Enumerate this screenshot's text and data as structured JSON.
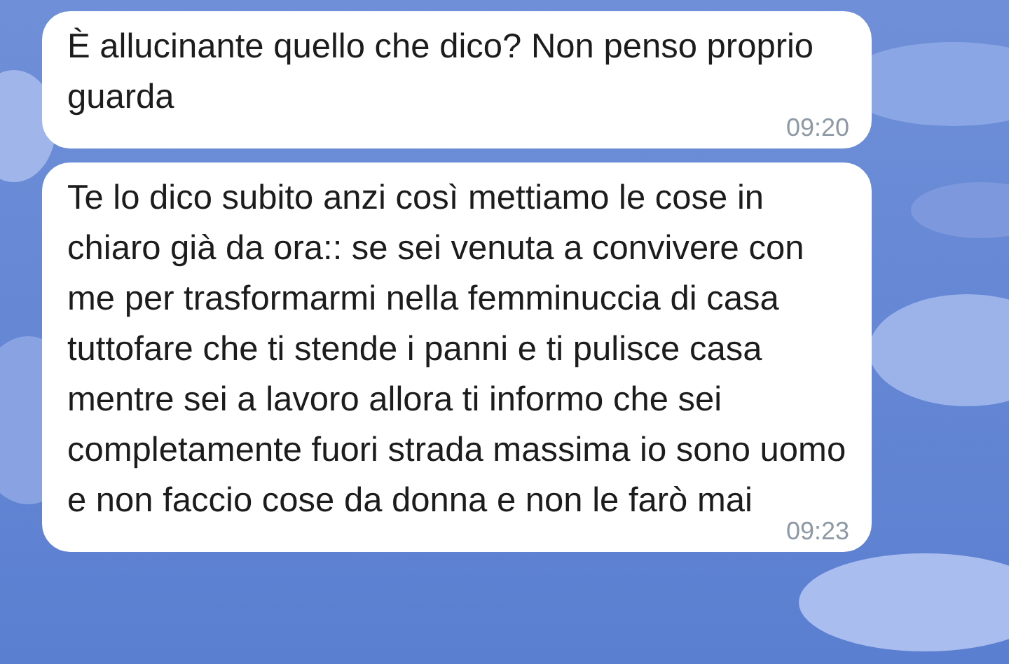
{
  "messages": [
    {
      "text": "È allucinante quello che dico? Non penso proprio guarda",
      "time": "09:20"
    },
    {
      "text": "Te lo dico subito anzi così mettiamo le cose in chiaro già da ora:: se sei venuta a convivere con me per trasformarmi nella femminuccia di casa tuttofare che ti stende i panni e ti pulisce casa mentre sei a lavoro allora ti informo che sei completamente fuori strada massima io sono uomo e non faccio cose da donna e non le farò mai",
      "time": "09:23"
    }
  ]
}
